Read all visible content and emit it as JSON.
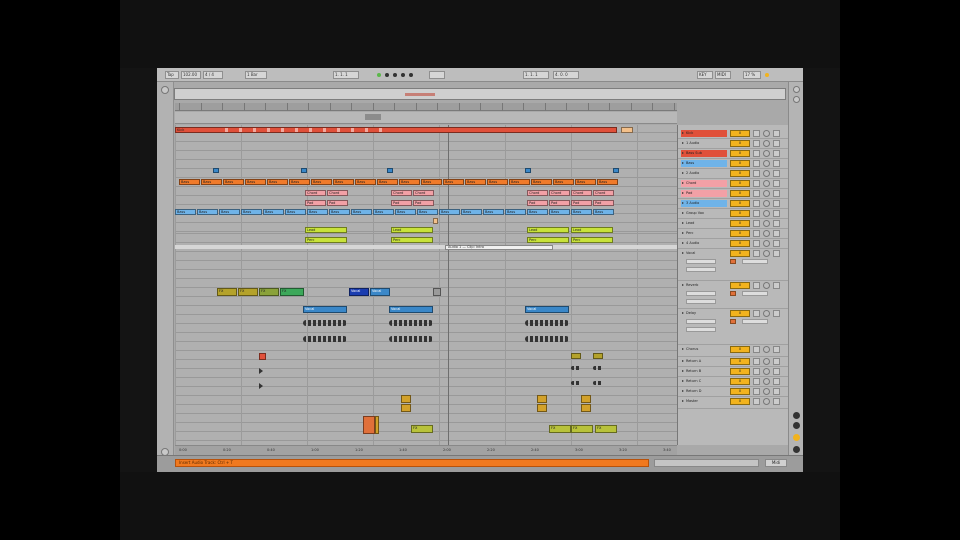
{
  "control_bar": {
    "tap_label": "Tap",
    "tempo": "102.00",
    "time_signature": "4 / 4",
    "quantize": "1 Bar",
    "position": "1. 1. 1",
    "loop_start": "1. 1. 1",
    "loop_length": "4. 0. 0",
    "key_label": "KEY",
    "midi_label": "MIDI",
    "cpu": "17 %"
  },
  "timeline": {
    "bar_labels": [
      "1",
      "9",
      "17",
      "25",
      "33",
      "41",
      "49",
      "57",
      "65",
      "73",
      "81",
      "89",
      "97",
      "105",
      "113",
      "121",
      "129",
      "137",
      "145",
      "153",
      "161",
      "169",
      "177",
      "185"
    ],
    "time_labels": [
      "0:00",
      "0:20",
      "0:40",
      "1:00",
      "1:20",
      "1:40",
      "2:00",
      "2:20",
      "2:40",
      "3:00",
      "3:20",
      "3:40"
    ]
  },
  "colors": {
    "red": "#e0503a",
    "orange": "#f07a2a",
    "blue": "#6fb3e8",
    "lime": "#c8e23a",
    "pink": "#f2a0a6",
    "olive": "#b4a22a",
    "green": "#3ca85a",
    "navy": "#1b3db0",
    "yellow": "#f2b31d"
  },
  "clips": {
    "kick": "Kick",
    "bass": "Bass",
    "chord": "Chord",
    "pad": "Pad",
    "vocal": "Vocal",
    "lead": "Lead",
    "fx": "FX",
    "perc": "Perc"
  },
  "popup": "Audio 1 — Clip: Intro",
  "mixer": {
    "tracks": [
      {
        "name": "Kick",
        "vol": "0",
        "color": "#e0503a"
      },
      {
        "name": "1 Audio",
        "vol": "0",
        "color": "#b9b9b9"
      },
      {
        "name": "Bass Sub",
        "vol": "0",
        "color": "#e0503a"
      },
      {
        "name": "Bass",
        "vol": "0",
        "color": "#6fb3e8"
      },
      {
        "name": "2 Audio",
        "vol": "0",
        "color": "#b9b9b9"
      },
      {
        "name": "Chord",
        "vol": "0",
        "color": "#f2a0a6"
      },
      {
        "name": "Pad",
        "vol": "0",
        "color": "#f2a0a6"
      },
      {
        "name": "3 Audio",
        "vol": "0",
        "color": "#6fb3e8"
      },
      {
        "name": "Group Vox",
        "vol": "0",
        "color": "#b9b9b9"
      },
      {
        "name": "Lead",
        "vol": "0",
        "color": "#b9b9b9"
      },
      {
        "name": "Perc",
        "vol": "0",
        "color": "#b9b9b9"
      },
      {
        "name": "4 Audio",
        "vol": "0",
        "color": "#b9b9b9"
      },
      {
        "name": "Vocal",
        "vol": "0",
        "color": "#b9b9b9"
      },
      {
        "name": "Reverb",
        "vol": "0",
        "color": "#b9b9b9"
      },
      {
        "name": "Delay",
        "vol": "0",
        "color": "#b9b9b9"
      },
      {
        "name": "Chorus",
        "vol": "0",
        "color": "#b9b9b9"
      },
      {
        "name": "Return A",
        "vol": "0",
        "color": "#b9b9b9"
      },
      {
        "name": "Return B",
        "vol": "0",
        "color": "#b9b9b9"
      },
      {
        "name": "Return C",
        "vol": "0",
        "color": "#b9b9b9"
      },
      {
        "name": "Return D",
        "vol": "0",
        "color": "#b9b9b9"
      },
      {
        "name": "Master",
        "vol": "0",
        "color": "#b9b9b9"
      }
    ]
  },
  "status": {
    "message": "Insert Audio Track: Ctrl + T",
    "button": "Midi"
  }
}
